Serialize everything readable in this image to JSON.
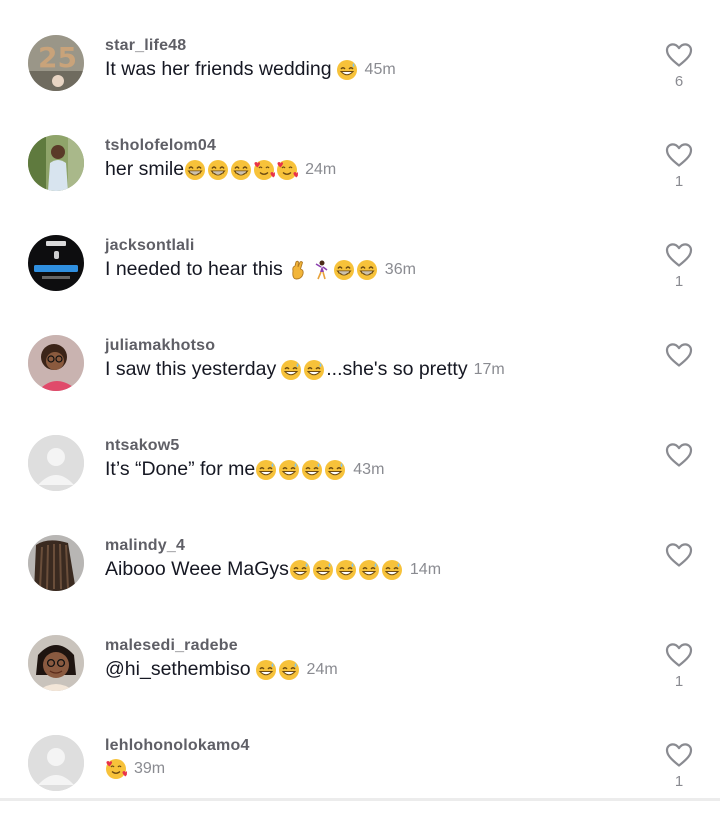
{
  "comments": [
    {
      "username": "star_life48",
      "text": "It was her friends wedding",
      "emojis": [
        "grin-sweat"
      ],
      "time": "45m",
      "likes": "6",
      "avatar": "balloons"
    },
    {
      "username": "tsholofelom04",
      "text": "her smile",
      "emojis": [
        "beaming",
        "beaming",
        "beaming",
        "smiling-hearts",
        "smiling-hearts"
      ],
      "time": "24m",
      "likes": "1",
      "avatar": "woman-outdoor"
    },
    {
      "username": "jacksontlali",
      "text": "I needed to hear this",
      "emojis": [
        "crossed-fingers",
        "dancer",
        "beaming",
        "beaming"
      ],
      "time": "36m",
      "likes": "1",
      "avatar": "instagram-dark"
    },
    {
      "username": "juliamakhotso",
      "text": "I saw this yesterday",
      "emojis": [
        "grin-sweat",
        "grin-sweat"
      ],
      "text_after": "...she's so pretty",
      "time": "17m",
      "likes": "",
      "avatar": "woman-glasses"
    },
    {
      "username": "ntsakow5",
      "text": "It’s “Done” for me",
      "emojis": [
        "grin-sweat",
        "grin-sweat",
        "grin-sweat",
        "grin-sweat"
      ],
      "time": "43m",
      "likes": "",
      "avatar": "default"
    },
    {
      "username": "malindy_4",
      "text": "Aibooo Weee MaGys",
      "emojis": [
        "grin-sweat",
        "grin-sweat",
        "grin-sweat",
        "grin-sweat",
        "grin-sweat"
      ],
      "time": "14m",
      "likes": "",
      "avatar": "braids"
    },
    {
      "username": "malesedi_radebe",
      "text": "@hi_sethembiso",
      "emojis": [
        "grin-sweat",
        "grin-sweat"
      ],
      "time": "24m",
      "likes": "1",
      "avatar": "woman-glasses-2"
    },
    {
      "username": "lehlohonolokamo4",
      "text": "",
      "emojis": [
        "smiling-hearts"
      ],
      "time": "39m",
      "likes": "1",
      "avatar": "default"
    }
  ],
  "icons": {
    "like": "heart-outline-icon"
  },
  "colors": {
    "username": "#5f5f66",
    "comment": "#161823",
    "meta": "#8a8b91"
  }
}
